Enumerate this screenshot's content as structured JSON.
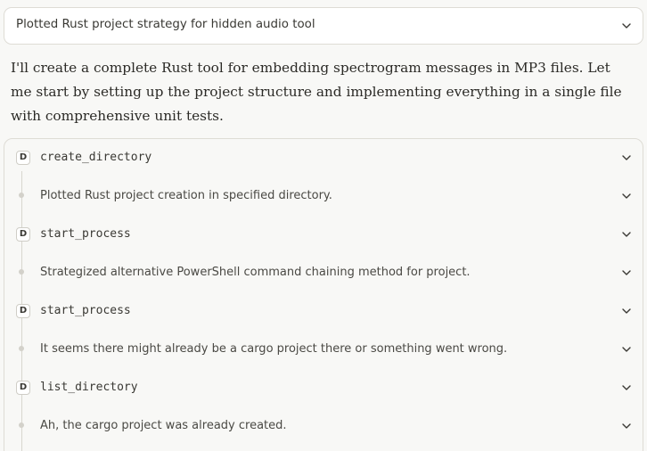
{
  "header": {
    "title": "Plotted Rust project strategy for hidden audio tool",
    "chevron_icon": "chevron-down-icon"
  },
  "intro_text": "I'll create a complete Rust tool for embedding spectrogram messages in MP3 files. Let me start by setting up the project structure and implementing everything in a single file with comprehensive unit tests.",
  "steps": [
    {
      "kind": "tool",
      "badge": "D",
      "label": "create_directory"
    },
    {
      "kind": "thought",
      "label": "Plotted Rust project creation in specified directory."
    },
    {
      "kind": "tool",
      "badge": "D",
      "label": "start_process"
    },
    {
      "kind": "thought",
      "label": "Strategized alternative PowerShell command chaining method for project."
    },
    {
      "kind": "tool",
      "badge": "D",
      "label": "start_process"
    },
    {
      "kind": "thought",
      "label": "It seems there might already be a cargo project there or something went wrong."
    },
    {
      "kind": "tool",
      "badge": "D",
      "label": "list_directory"
    },
    {
      "kind": "thought",
      "label": "Ah, the cargo project was already created."
    }
  ]
}
